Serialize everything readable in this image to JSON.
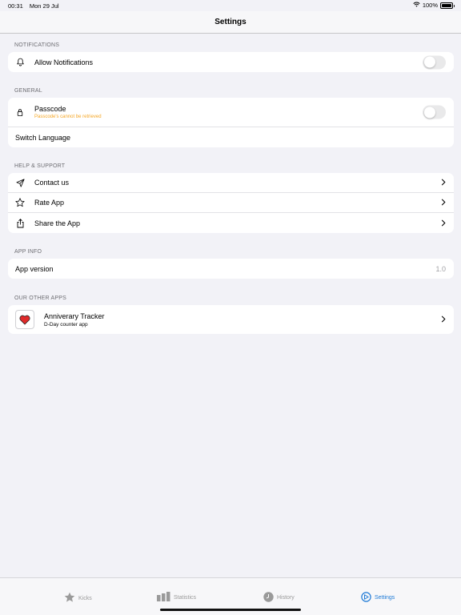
{
  "status_bar": {
    "time": "00:31",
    "date": "Mon 29 Jul",
    "battery": "100%"
  },
  "nav": {
    "title": "Settings"
  },
  "sections": {
    "notifications": {
      "header": "NOTIFICATIONS",
      "allow_label": "Allow Notifications",
      "allow_on": false
    },
    "general": {
      "header": "GENERAL",
      "passcode_label": "Passcode",
      "passcode_note": "Passcode's cannot be retrieved",
      "passcode_on": false,
      "language_label": "Switch Language"
    },
    "help": {
      "header": "HELP & SUPPORT",
      "items": [
        {
          "label": "Contact us",
          "icon": "paper-plane-icon"
        },
        {
          "label": "Rate App",
          "icon": "star-icon"
        },
        {
          "label": "Share the App",
          "icon": "share-icon"
        }
      ]
    },
    "app_info": {
      "header": "APP INFO",
      "version_label": "App version",
      "version_value": "1.0"
    },
    "other_apps": {
      "header": "OUR OTHER APPS",
      "app_name": "Anniverary Tracker",
      "app_desc": "D-Day counter app"
    }
  },
  "tabs": [
    {
      "label": "Kicks",
      "icon": "star-icon",
      "active": false
    },
    {
      "label": "Statistics",
      "icon": "bar-chart-icon",
      "active": false
    },
    {
      "label": "History",
      "icon": "clock-icon",
      "active": false
    },
    {
      "label": "Settings",
      "icon": "gear-icon",
      "active": true
    }
  ],
  "colors": {
    "accent": "#1e7ad6",
    "warning": "#f5a623",
    "background": "#f2f2f7"
  }
}
